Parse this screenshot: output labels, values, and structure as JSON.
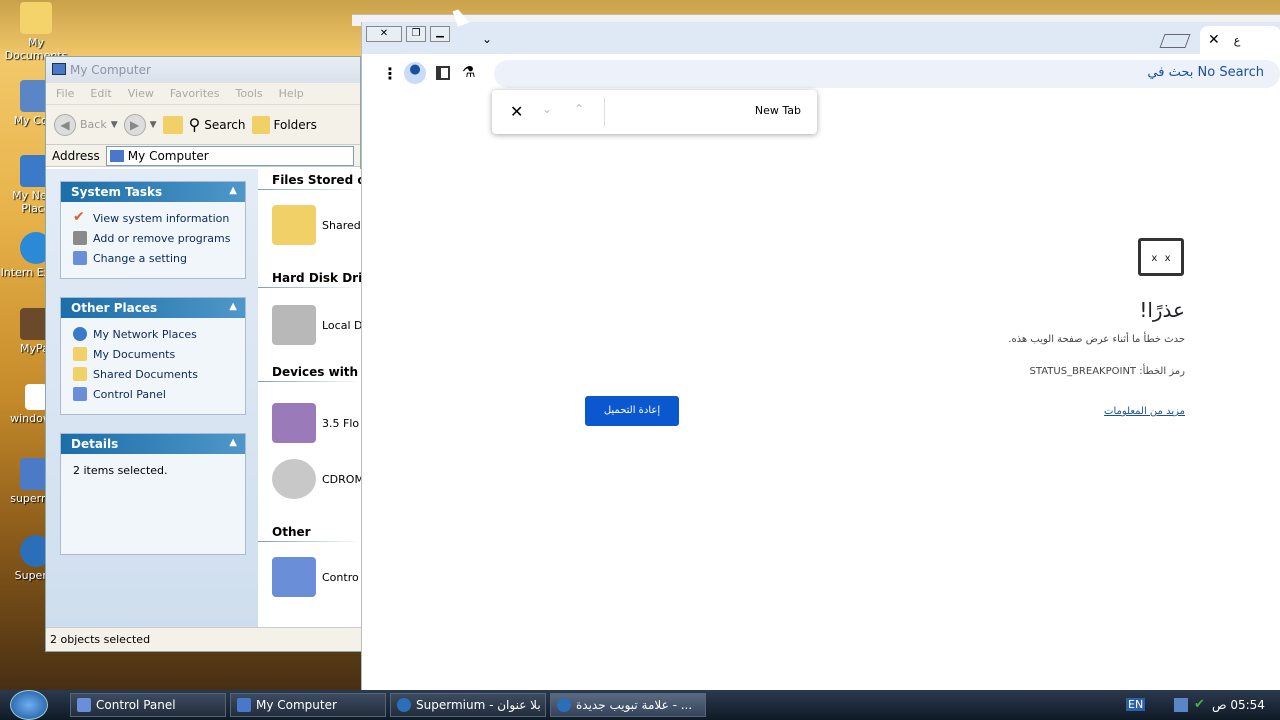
{
  "desktop": {
    "icons": [
      {
        "label": "My Documents"
      },
      {
        "label": "My Com"
      },
      {
        "label": "My Netw Place"
      },
      {
        "label": "Intern Explor"
      },
      {
        "label": "MyPal"
      },
      {
        "label": "windowst"
      },
      {
        "label": "supermiu"
      },
      {
        "label": "Superm"
      }
    ]
  },
  "explorer": {
    "title": "My Computer",
    "menu": [
      "File",
      "Edit",
      "View",
      "Favorites",
      "Tools",
      "Help"
    ],
    "toolbar": {
      "back": "Back",
      "search": "Search",
      "folders": "Folders"
    },
    "address_label": "Address",
    "address_value": "My Computer",
    "system_tasks": {
      "title": "System Tasks",
      "items": [
        "View system information",
        "Add or remove programs",
        "Change a setting"
      ]
    },
    "other_places": {
      "title": "Other Places",
      "items": [
        "My Network Places",
        "My Documents",
        "Shared Documents",
        "Control Panel"
      ]
    },
    "details": {
      "title": "Details",
      "text": "2 items selected."
    },
    "sections": {
      "files": "Files Stored on T",
      "hdd": "Hard Disk Drive",
      "devices": "Devices with Re",
      "other": "Other"
    },
    "items": {
      "shared": "Shared",
      "local": "Local D",
      "floppy": "3.5 Flo",
      "cdrom": "CDROM",
      "control": "Contro"
    },
    "status": "2 objects selected"
  },
  "browser": {
    "tab_label": "ﻉ",
    "omnibox": "بحث في No Search",
    "find_text": "New Tab",
    "error_title": "عذرًا!",
    "error_msg": "حدث خطأ ما أثناء عرض صفحة الويب هذه.",
    "error_code": "رمز الخطأ: STATUS_BREAKPOINT",
    "more_info": "مزيد من المعلومات",
    "reload": "إعادة التحميل"
  },
  "taskbar": {
    "buttons": [
      "Control Panel",
      "My Computer",
      "Supermium - بلا عنوان",
      "علامة تبويب جديدة - ..."
    ],
    "lang": "EN",
    "clock": "05:54 ص"
  },
  "colors": {
    "accent": "#0b57d0",
    "panel_header": "#1c6ea8"
  }
}
